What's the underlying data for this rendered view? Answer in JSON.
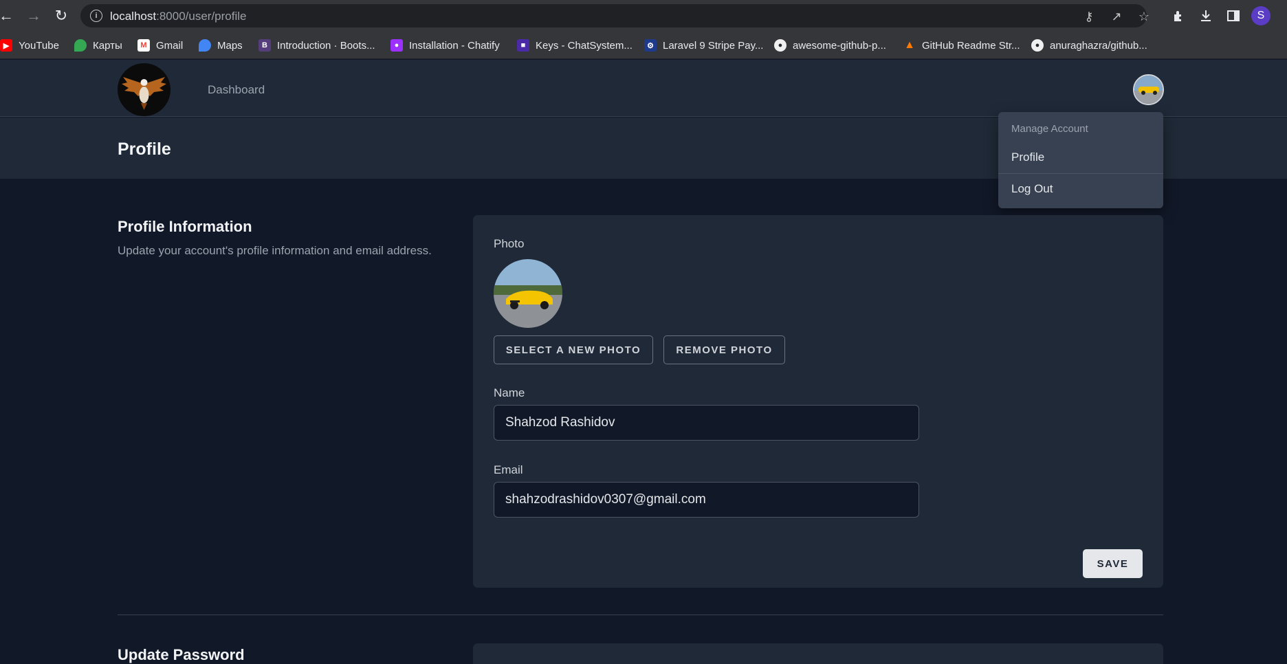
{
  "browser": {
    "url_host": "localhost",
    "url_rest": ":8000/user/profile",
    "profile_initial": "S",
    "bookmarks": [
      {
        "label": "YouTube",
        "icon": "youtube-icon",
        "color": "#ff0000"
      },
      {
        "label": "Карты",
        "icon": "maps-pin-icon",
        "color": "#34a853"
      },
      {
        "label": "Gmail",
        "icon": "gmail-icon",
        "color": "#ea4335"
      },
      {
        "label": "Maps",
        "icon": "maps-pin-icon",
        "color": "#4285f4"
      },
      {
        "label": "Introduction · Boots...",
        "icon": "bootstrap-icon",
        "color": "#563d7c"
      },
      {
        "label": "Installation - Chatify",
        "icon": "chatify-icon",
        "color": "#9b30ff"
      },
      {
        "label": "Keys - ChatSystem...",
        "icon": "keys-icon",
        "color": "#4b2aa8"
      },
      {
        "label": "Laravel 9 Stripe Pay...",
        "icon": "laravel-icon",
        "color": "#1e3a8a"
      },
      {
        "label": "awesome-github-p...",
        "icon": "github-icon",
        "color": "#24292f"
      },
      {
        "label": "GitHub Readme Str...",
        "icon": "fire-icon",
        "color": "#ff7a00"
      },
      {
        "label": "anuraghazra/github...",
        "icon": "github-icon",
        "color": "#24292f"
      }
    ]
  },
  "nav": {
    "dashboard": "Dashboard"
  },
  "header": {
    "title": "Profile"
  },
  "dropdown": {
    "heading": "Manage Account",
    "profile": "Profile",
    "logout": "Log Out"
  },
  "profile_info": {
    "title": "Profile Information",
    "description": "Update your account's profile information and email address.",
    "photo_label": "Photo",
    "select_photo": "SELECT A NEW PHOTO",
    "remove_photo": "REMOVE PHOTO",
    "name_label": "Name",
    "name_value": "Shahzod Rashidov",
    "email_label": "Email",
    "email_value": "shahzodrashidov0307@gmail.com",
    "save": "SAVE"
  },
  "update_password": {
    "title": "Update Password"
  },
  "colors": {
    "page_bg": "#111827",
    "card_bg": "#1f2937",
    "dropdown_bg": "#374151"
  }
}
